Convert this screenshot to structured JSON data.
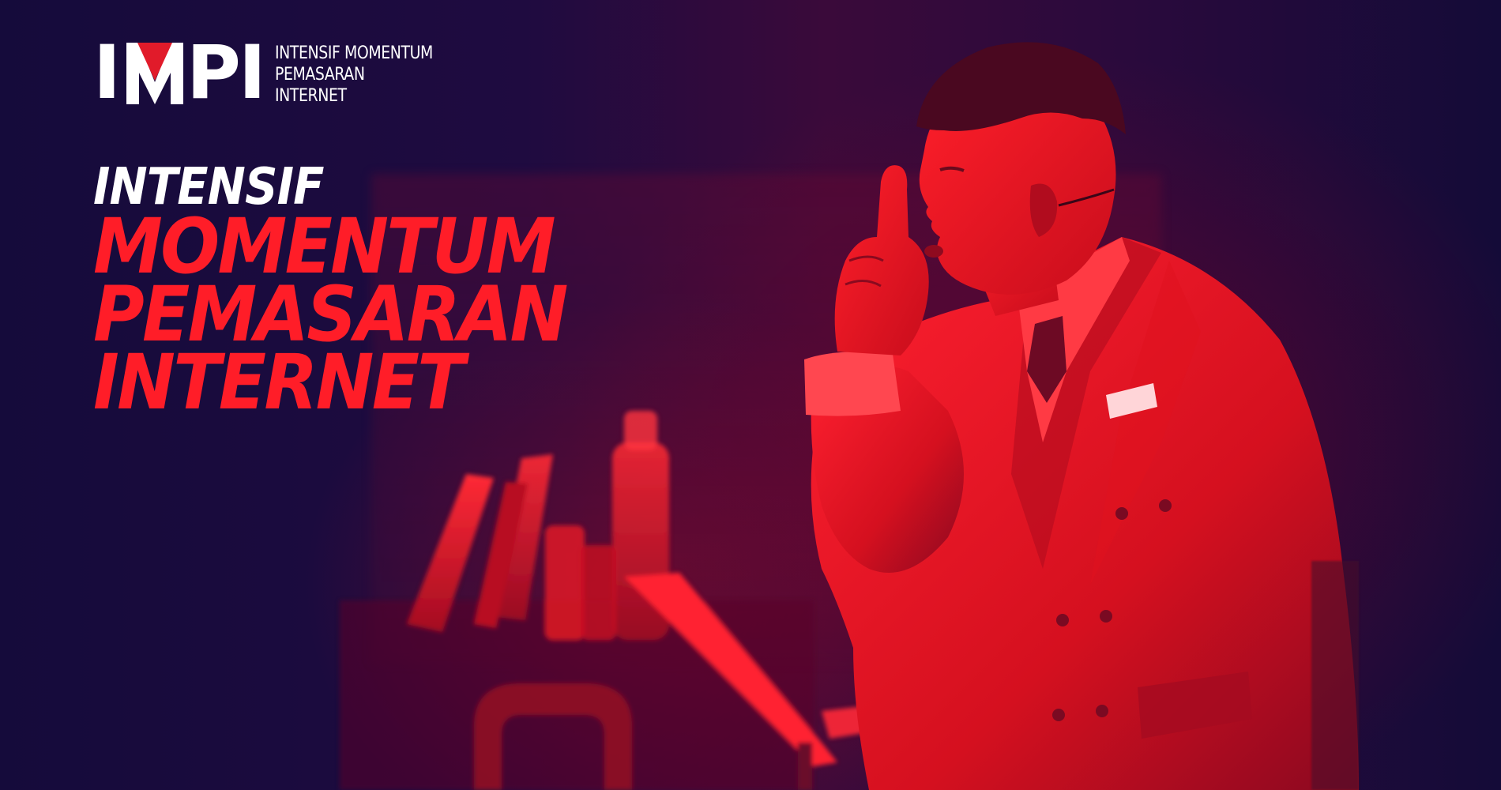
{
  "logo": {
    "letters": [
      "I",
      "M",
      "P",
      "I"
    ],
    "tagline": [
      "INTENSIF MOMENTUM",
      "PEMASARAN",
      "INTERNET"
    ]
  },
  "headline": {
    "line1": "INTENSIF",
    "line2": "MOMENTUM",
    "line3": "PEMASARAN",
    "line4": "INTERNET"
  },
  "colors": {
    "accent_red": "#ff1d28",
    "text_white": "#ffffff",
    "background_navy": "#150b3b"
  }
}
